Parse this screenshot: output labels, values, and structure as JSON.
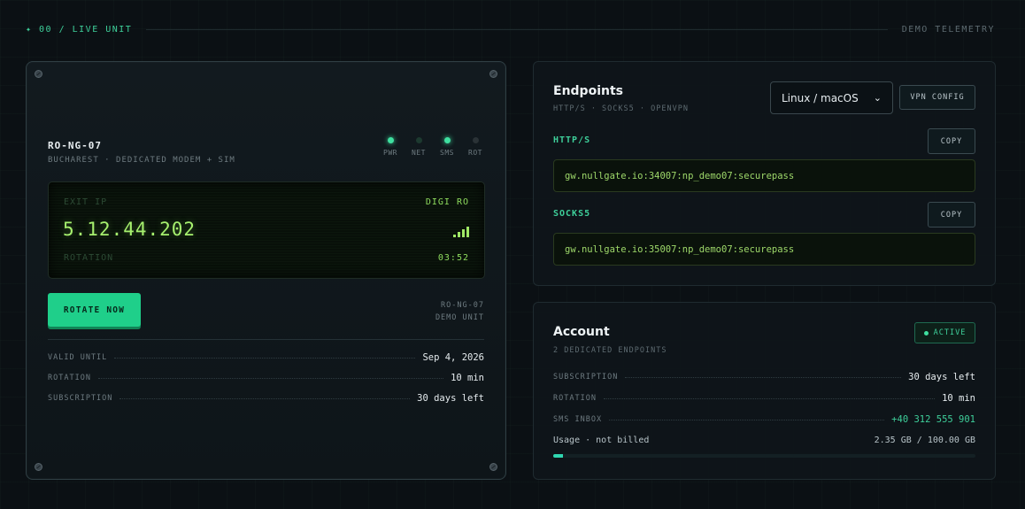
{
  "topbar": {
    "left_label": "✦ 00 / LIVE UNIT",
    "right_label": "DEMO TELEMETRY"
  },
  "unit": {
    "name": "RO-NG-07",
    "subtitle": "BUCHAREST · DEDICATED MODEM + SIM",
    "leds": [
      {
        "label": "PWR",
        "state": "on"
      },
      {
        "label": "NET",
        "state": "dim"
      },
      {
        "label": "SMS",
        "state": "on"
      },
      {
        "label": "ROT",
        "state": "off"
      }
    ],
    "display": {
      "exit_label": "EXIT IP",
      "carrier": "DIGI RO",
      "ip": "5.12.44.202",
      "signal_bars": 4,
      "rotation_label": "ROTATION",
      "timer": "03:52"
    },
    "rotate_button": "ROTATE NOW",
    "tag_line1": "RO-NG-07",
    "tag_line2": "DEMO UNIT",
    "specs": [
      {
        "key": "VALID UNTIL",
        "value": "Sep 4, 2026"
      },
      {
        "key": "ROTATION",
        "value": "10 min"
      },
      {
        "key": "SUBSCRIPTION",
        "value": "30 days left"
      }
    ]
  },
  "endpoints": {
    "title": "Endpoints",
    "subtitle": "HTTP/S · SOCKS5 · OPENVPN",
    "os_selected": "Linux / macOS",
    "vpn_button": "VPN CONFIG",
    "items": [
      {
        "label": "HTTP/S",
        "copy": "COPY",
        "value": "gw.nullgate.io:34007:np_demo07:securepass"
      },
      {
        "label": "SOCKS5",
        "copy": "COPY",
        "value": "gw.nullgate.io:35007:np_demo07:securepass"
      }
    ]
  },
  "account": {
    "title": "Account",
    "subtitle": "2 DEDICATED ENDPOINTS",
    "status": "ACTIVE",
    "rows": [
      {
        "key": "SUBSCRIPTION",
        "value": "30 days left"
      },
      {
        "key": "ROTATION",
        "value": "10 min"
      },
      {
        "key": "SMS INBOX",
        "value": "+40 312 555 901"
      }
    ],
    "usage_label": "Usage · not billed",
    "usage_value": "2.35 GB / 100.00 GB",
    "usage_fraction": 0.0235
  },
  "colors": {
    "accent": "#3ecf9a",
    "button": "#1fcf8a",
    "lcd_text": "#a6f06e"
  }
}
